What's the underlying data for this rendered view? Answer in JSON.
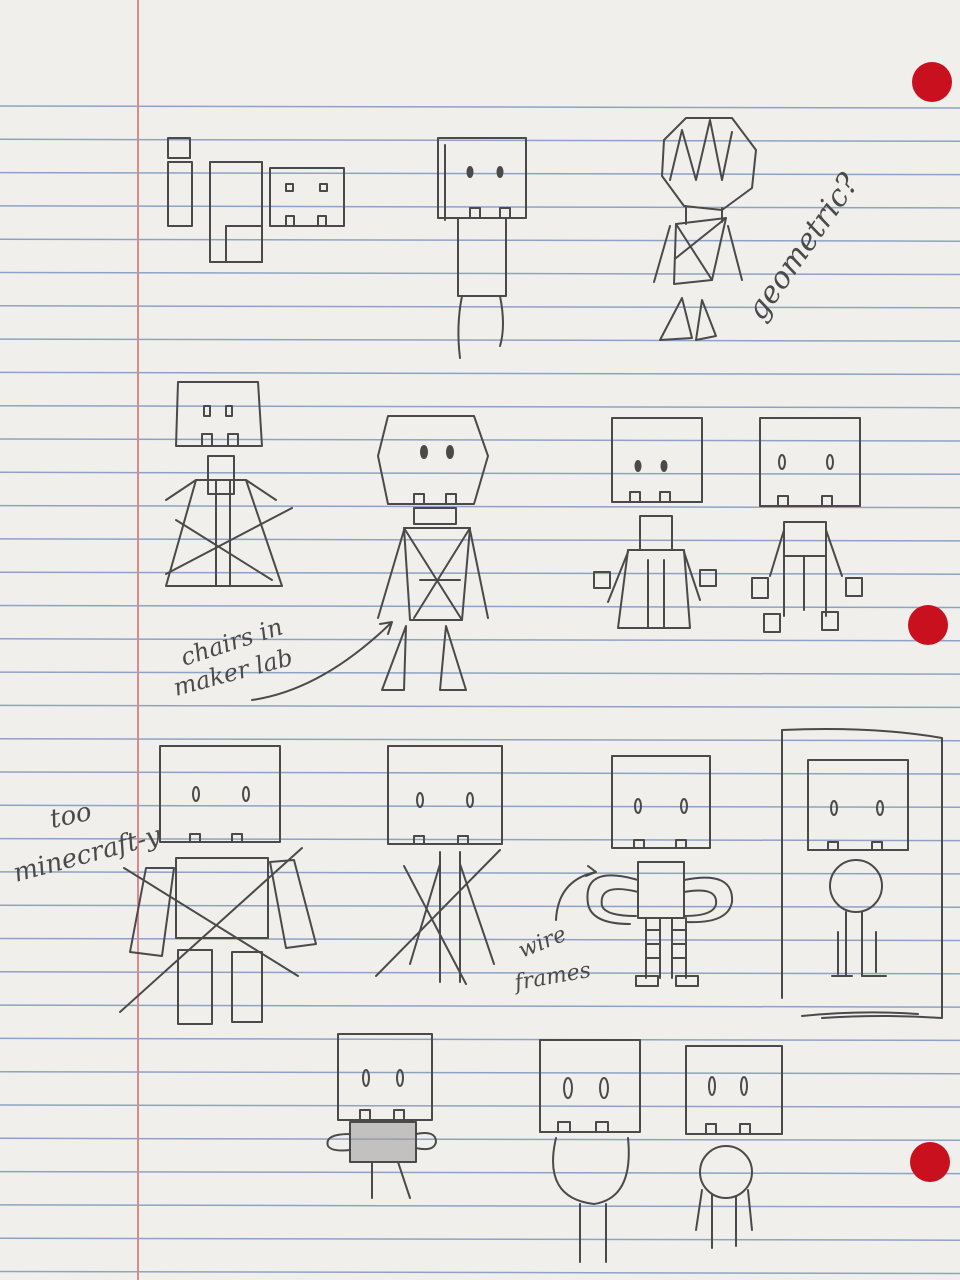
{
  "paper": {
    "background": "#f1efec",
    "rule_color": "#8ea2c4",
    "margin_color": "#d88a93",
    "hole_color": "#c8101e",
    "pencil_color": "#4a4a4a"
  },
  "annotations": {
    "geometric": "geometric?",
    "chairs_line1": "chairs in",
    "chairs_line2": "maker lab",
    "minecraft_line1": "too",
    "minecraft_line2": "minecraft-y",
    "wire_line1": "wire",
    "wire_line2": "frames"
  }
}
